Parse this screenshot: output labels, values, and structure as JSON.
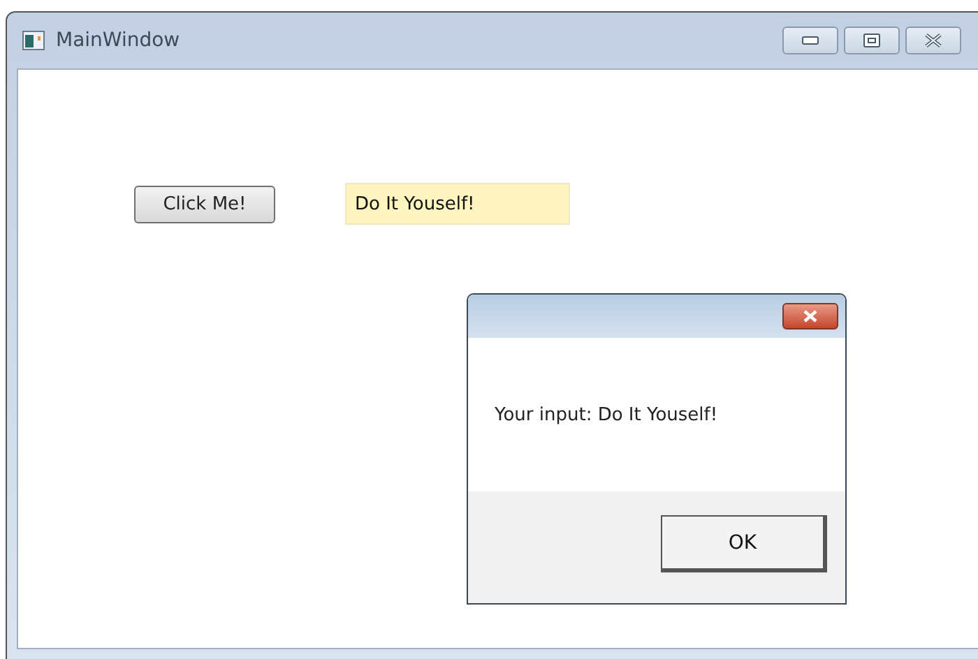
{
  "window": {
    "title": "MainWindow"
  },
  "button": {
    "label": "Click Me!"
  },
  "text_field": {
    "value": "Do It Youself!"
  },
  "dialog": {
    "message": "Your input: Do It Youself!",
    "ok_button": "OK"
  }
}
